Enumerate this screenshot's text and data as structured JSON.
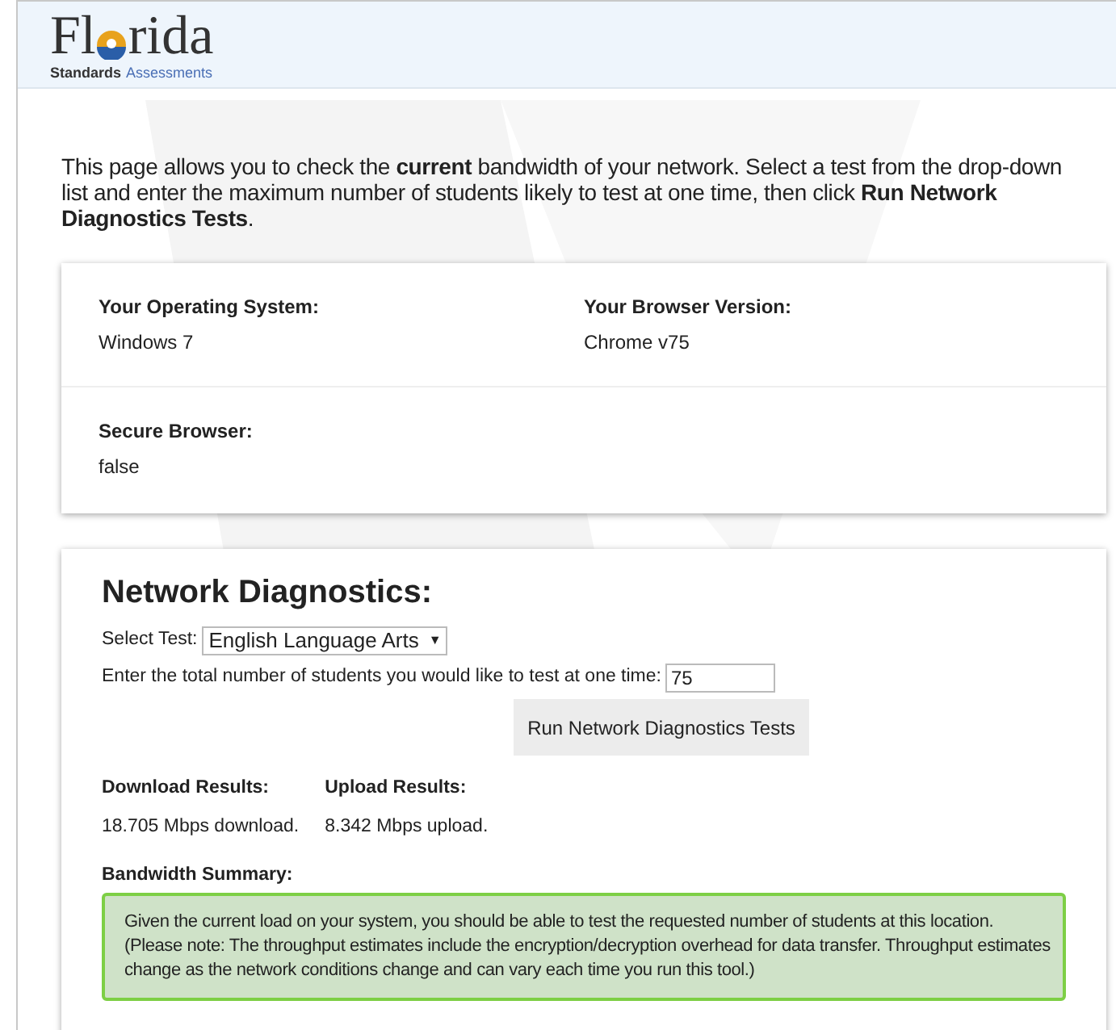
{
  "logo": {
    "title_parts": [
      "Fl",
      "rida"
    ],
    "subtitle_parts": [
      "Standards",
      "Assessments"
    ]
  },
  "intro": "This page allows you to check the **current** bandwidth of your network. Select a test from the drop-down list and enter the maximum number of students likely to test at one time, then click **Run Network Diagnostics Tests**.",
  "system_info": [
    {
      "label": "Your Operating System:",
      "value": "Windows 7"
    },
    {
      "label": "Your Browser Version:",
      "value": "Chrome v75"
    },
    {
      "label": "Secure Browser:",
      "value": "false"
    }
  ],
  "diagnostics": {
    "title": "Network Diagnostics:",
    "select_label": "Select Test:",
    "select_value": "English Language Arts",
    "caret": "▼",
    "students_label": "Enter the total number of students you would like to test at one time:",
    "students_value": "75",
    "run_button": "Run Network Diagnostics Tests",
    "results": [
      {
        "label": "Download Results:",
        "value": "18.705 Mbps download."
      },
      {
        "label": "Upload Results:",
        "value": "8.342 Mbps upload."
      }
    ],
    "summary_label": "Bandwidth Summary:",
    "summary": "Given the current load on your system, you should be able to test the requested number of students at this location. (Please note: The throughput estimates include the encryption/decryption overhead for data transfer. Throughput estimates change as the network conditions change and can vary each time you run this tool.)"
  }
}
